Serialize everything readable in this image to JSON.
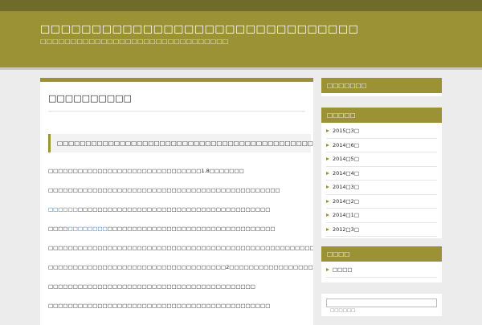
{
  "header": {
    "title": "□□□□□□□□□□□□□□□□□□□□□□□□□□□□□□□",
    "description": "□□□□□□□□□□□□□□□□□□□□□□□□□□□□□□□"
  },
  "article": {
    "title": "□□□□□□□□□□",
    "quote": "□□□□□□□□□□□□□□□□□□□□□□□□□□□□□□□□□□□□□□□□□□□□□□□□□□□□□□□□□□□□□□□□□□",
    "paragraphs": [
      {
        "pre": "□□□□□□□□□□□□□□□□□□□□□□□□□□□□□□□1.8□□□□□□□",
        "link": "",
        "post": ""
      },
      {
        "pre": "□□□□□□□□□□□□□□□□□□□□□□□□□□□□□□□□□□□□□□□□□□□□□□□",
        "link": "",
        "post": ""
      },
      {
        "pre": "",
        "link": "□□□□□□",
        "post": "□□□□□□□□□□□□□□□□□□□□□□□□□□□□□□□□□□□□□□□"
      },
      {
        "pre": "□□□□",
        "link": "□□□□□□□□",
        "post": "□□□□□□□□□□□□□□□□□□□□□□□□□□□□□□□□□□"
      },
      {
        "pre": "□□□□□□□□□□□□□□□□□□□□□□□□□□□□□□□□□□□□□□□□□□□□□□□□□□□□□□□□□",
        "link": "",
        "post": ""
      },
      {
        "pre": "□□□□□□□□□□□□□□□□□□□□□□□□□□□□□□□□□□□□2□□□□□□□□□□□□□□□□□□□□□□□□□□□□□□□",
        "link": "",
        "post": ""
      },
      {
        "pre": "□□□□□□□□□□□□□□□□□□□□□□□□□□□□□□□□□□□□□□□□□□",
        "link": "",
        "post": ""
      },
      {
        "pre": "□□□□□□□□□□□□□□□□□□□□□□□□□□□□□□□□□□□□□□□□□□□□□",
        "link": "",
        "post": ""
      }
    ]
  },
  "sidebar": {
    "widget1": {
      "title": "□□□□□□□"
    },
    "archives": {
      "title": "□□□□□",
      "items": [
        "2015□3□",
        "2014□6□",
        "2014□5□",
        "2014□4□",
        "2014□3□",
        "2014□2□",
        "2014□1□",
        "2012□3□"
      ]
    },
    "categories": {
      "title": "□□□□",
      "items": [
        "□□□□"
      ]
    },
    "search": {
      "placeholder": "□□□□□□"
    }
  },
  "colors": {
    "header": "#9a9234",
    "topbar": "#6f6c2a",
    "accent": "#9a9234",
    "link": "#1a5fa8",
    "background": "#ececec"
  }
}
